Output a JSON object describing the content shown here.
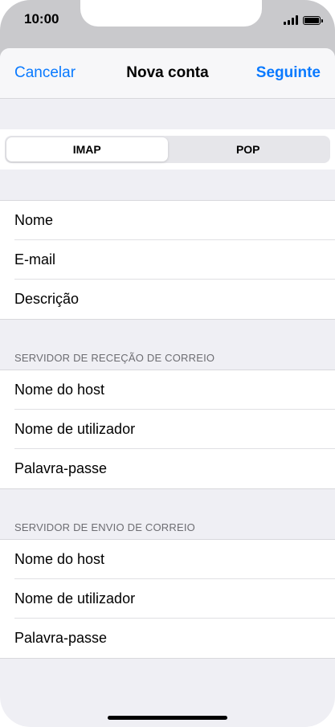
{
  "status_bar": {
    "time": "10:00",
    "icons": [
      "signal-icon",
      "battery-icon"
    ]
  },
  "navbar": {
    "cancel_label": "Cancelar",
    "title": "Nova conta",
    "next_label": "Seguinte"
  },
  "segmented": {
    "options": [
      "IMAP",
      "POP"
    ],
    "selected": "IMAP"
  },
  "account_fields": [
    "Nome",
    "E-mail",
    "Descrição"
  ],
  "incoming": {
    "header": "SERVIDOR DE RECEÇÃO DE CORREIO",
    "fields": [
      "Nome do host",
      "Nome de utilizador",
      "Palavra-passe"
    ]
  },
  "outgoing": {
    "header": "SERVIDOR DE ENVIO DE CORREIO",
    "fields": [
      "Nome do host",
      "Nome de utilizador",
      "Palavra-passe"
    ]
  },
  "colors": {
    "accent": "#0a7aff",
    "grouped_background": "#efeff4",
    "section_header_text": "#6d6d72"
  }
}
